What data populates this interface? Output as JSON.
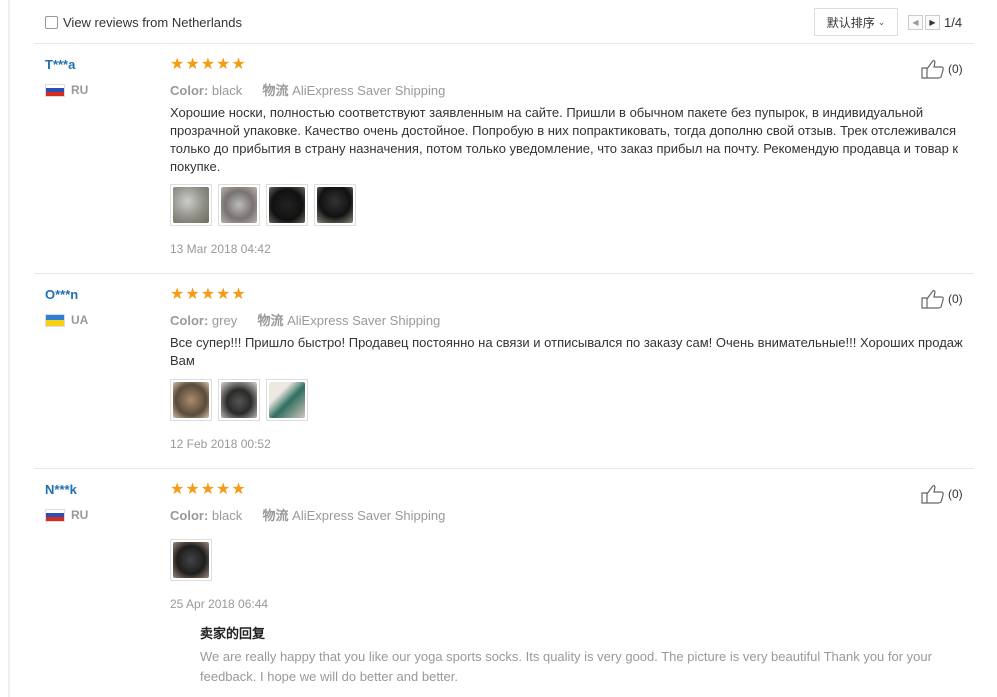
{
  "filter": {
    "label": "View reviews from Netherlands"
  },
  "sort": {
    "label": "默认排序"
  },
  "pager": {
    "text": "1/4"
  },
  "meta_labels": {
    "color": "Color:",
    "shipping": "物流"
  },
  "reviews": [
    {
      "user": "T***a",
      "country": "RU",
      "rating": 5,
      "color": "black",
      "shipping": "AliExpress Saver Shipping",
      "text": "Хорошие носки, полностью соответствуют заявленным на сайте. Пришли в обычном пакете без пупырок, в индивидуальной прозрачной упаковке. Качество очень достойное. Попробую в них попрактиковать, тогда дополню свой отзыв. Трек отслеживался только до прибытия в страну назначения, потом только уведомление, что заказ прибыл на почту. Рекомендую продавца и товар к покупке.",
      "photo_count": 4,
      "date": "13 Mar 2018 04:42",
      "likes": "(0)"
    },
    {
      "user": "O***n",
      "country": "UA",
      "rating": 5,
      "color": "grey",
      "shipping": "AliExpress Saver Shipping",
      "text": "Все супер!!! Пришло быстро! Продавец постоянно на связи и отписывался по заказу сам! Очень внимательные!!! Хороших продаж Вам",
      "photo_count": 3,
      "date": "12 Feb 2018 00:52",
      "likes": "(0)"
    },
    {
      "user": "N***k",
      "country": "RU",
      "rating": 5,
      "color": "black",
      "shipping": "AliExpress Saver Shipping",
      "text": "",
      "photo_count": 1,
      "date": "25 Apr 2018 06:44",
      "likes": "(0)",
      "seller_reply": {
        "title": "卖家的回复",
        "text": "We are really happy that you like our yoga sports socks. Its quality is very good. The picture is very beautiful Thank you for your feedback. I hope we will do better and better."
      }
    }
  ],
  "colors": {
    "star": "#f59c16",
    "user_link": "#1e6fb3",
    "muted": "#999999"
  },
  "icons": {
    "like": "thumbs-up-icon",
    "pager_prev": "chevron-left-icon",
    "pager_next": "chevron-right-icon",
    "sort": "chevron-down-icon"
  }
}
